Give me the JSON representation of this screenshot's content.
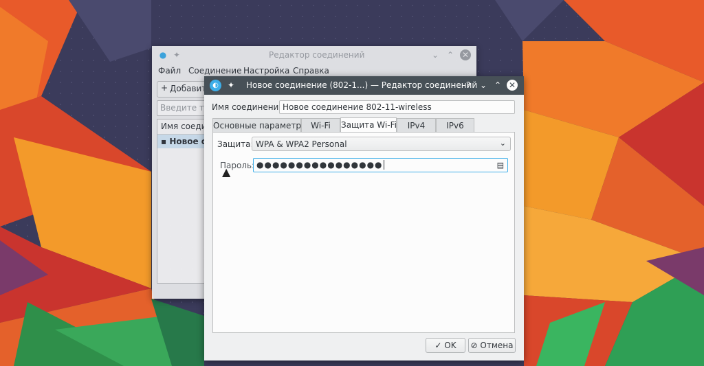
{
  "background_window": {
    "title": "Редактор соединений",
    "menu": [
      "Файл",
      "Соединение",
      "Настройка",
      "Справка"
    ],
    "add_button": "Добавить",
    "search_placeholder": "Введите те",
    "list_header": "Имя соеди",
    "list_item": "Новое со"
  },
  "dialog": {
    "title": "Новое соединение (802-1...) — Редактор соединений",
    "help_glyph": "?",
    "connection_name_label": "Имя соединения:",
    "connection_name_value": "Новое соединение 802-11-wireless",
    "tabs": [
      {
        "label": "Основные параметры"
      },
      {
        "label": "Wi-Fi"
      },
      {
        "label": "Защита Wi-Fi"
      },
      {
        "label": "IPv4"
      },
      {
        "label": "IPv6"
      }
    ],
    "security_label": "Защита:",
    "security_value": "WPA & WPA2 Personal",
    "password_label": "Пароль:",
    "password_value": "●●●●●●●●●●●●●●●●",
    "ok_label": "OK",
    "cancel_label": "Отмена"
  },
  "colors": {
    "titlebar_active": "#475057",
    "accent": "#3daee9"
  }
}
